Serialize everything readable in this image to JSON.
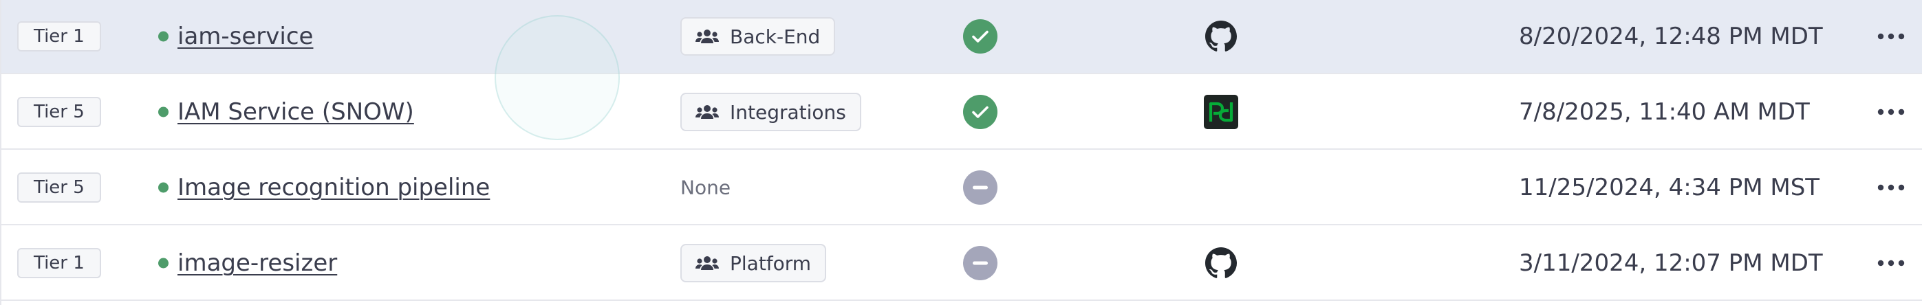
{
  "rows": [
    {
      "tier": "Tier 1",
      "name": "iam-service",
      "team": "Back-End",
      "check_state": "passing",
      "integration": "github-icon",
      "timestamp": "8/20/2024, 12:48 PM MDT"
    },
    {
      "tier": "Tier 5",
      "name": "IAM Service (SNOW)",
      "team": "Integrations",
      "check_state": "passing",
      "integration": "pagerduty-icon",
      "integration_text": "pd",
      "timestamp": "7/8/2025, 11:40 AM MDT"
    },
    {
      "tier": "Tier 5",
      "name": "Image recognition pipeline",
      "team_none": "None",
      "check_state": "none",
      "integration": "",
      "timestamp": "11/25/2024, 4:34 PM MST"
    },
    {
      "tier": "Tier 1",
      "name": "image-resizer",
      "team": "Platform",
      "check_state": "none",
      "integration": "github-icon",
      "timestamp": "3/11/2024, 12:07 PM MDT"
    }
  ],
  "colors": {
    "hover_row": "#e6eaf3",
    "status_dot": "#4e9c6a",
    "check_ok": "#4e9c6a",
    "check_none": "#a4a6ba",
    "pagerduty_green": "#06ac38"
  },
  "icons": {
    "team": "users-icon",
    "more": "ellipsis-icon",
    "check_ok": "checkmark-icon",
    "check_none": "minus-icon"
  }
}
